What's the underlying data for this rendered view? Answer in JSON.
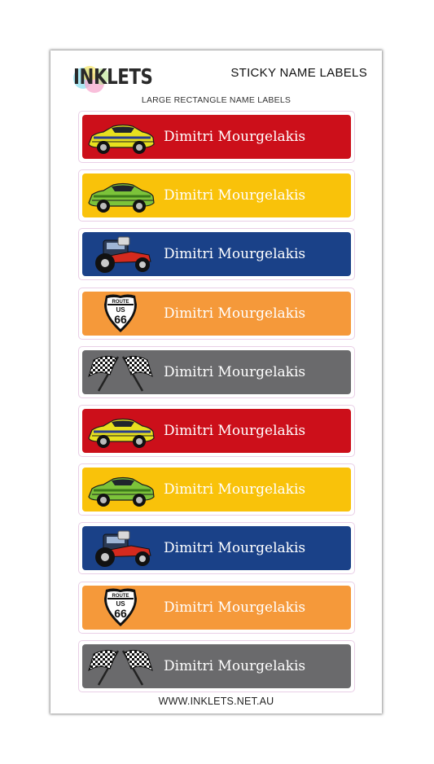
{
  "brand": {
    "logo_text": "INKLETS"
  },
  "header": {
    "title": "STICKY NAME LABELS",
    "subtitle": "LARGE RECTANGLE NAME LABELS"
  },
  "labels": [
    {
      "name": "Dimitri Mourgelakis",
      "color": "#cc0f1a",
      "icon": "yellow-muscle-car-icon"
    },
    {
      "name": "Dimitri Mourgelakis",
      "color": "#f9c20a",
      "icon": "green-sports-car-icon"
    },
    {
      "name": "Dimitri Mourgelakis",
      "color": "#1a4188",
      "icon": "hot-rod-car-icon"
    },
    {
      "name": "Dimitri Mourgelakis",
      "color": "#f5993a",
      "icon": "route-66-sign-icon"
    },
    {
      "name": "Dimitri Mourgelakis",
      "color": "#6a6a6c",
      "icon": "checkered-flags-icon"
    },
    {
      "name": "Dimitri Mourgelakis",
      "color": "#cc0f1a",
      "icon": "yellow-muscle-car-icon"
    },
    {
      "name": "Dimitri Mourgelakis",
      "color": "#f9c20a",
      "icon": "green-sports-car-icon"
    },
    {
      "name": "Dimitri Mourgelakis",
      "color": "#1a4188",
      "icon": "hot-rod-car-icon"
    },
    {
      "name": "Dimitri Mourgelakis",
      "color": "#f5993a",
      "icon": "route-66-sign-icon"
    },
    {
      "name": "Dimitri Mourgelakis",
      "color": "#6a6a6c",
      "icon": "checkered-flags-icon"
    }
  ],
  "route_sign": {
    "top": "ROUTE",
    "mid": "US",
    "num": "66"
  },
  "footer": {
    "url": "WWW.INKLETS.NET.AU"
  }
}
